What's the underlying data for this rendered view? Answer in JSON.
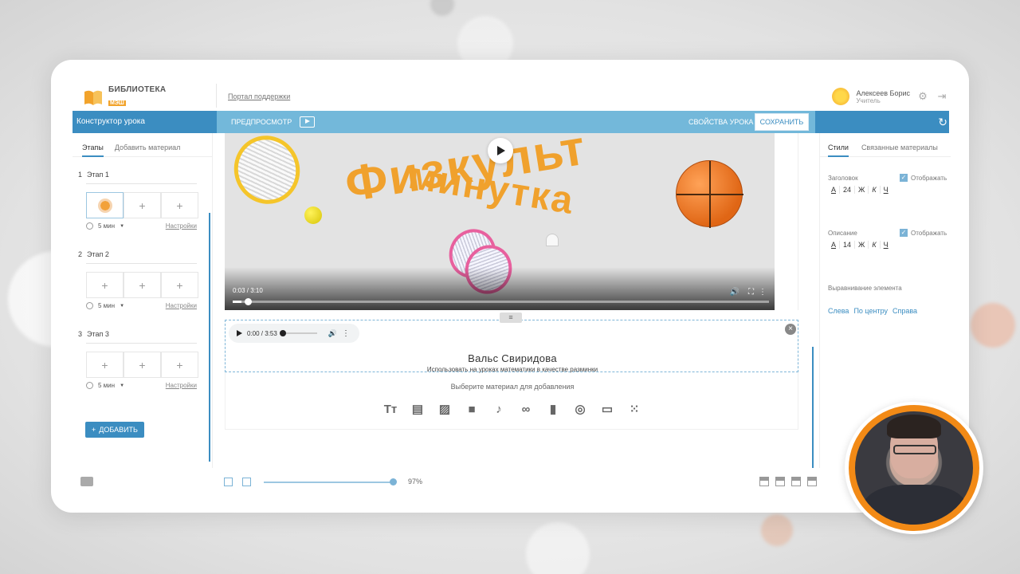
{
  "app": {
    "logo_line1": "БИБЛИОТЕКА",
    "logo_line2": "МЭШ",
    "support_link": "Портал поддержки"
  },
  "user": {
    "name": "Алексеев Борис",
    "role": "Учитель"
  },
  "toolbar": {
    "section_title": "Конструктор урока",
    "preview_label": "ПРЕДПРОСМОТР",
    "properties_label": "СВОЙСТВА УРОКА",
    "save_label": "СОХРАНИТЬ"
  },
  "left_panel": {
    "tabs": [
      "Этапы",
      "Добавить материал"
    ],
    "stages": [
      {
        "num": "1",
        "title": "Этап 1",
        "duration": "5 мин",
        "settings": "Настройки"
      },
      {
        "num": "2",
        "title": "Этап 2",
        "duration": "5 мин",
        "settings": "Настройки"
      },
      {
        "num": "3",
        "title": "Этап 3",
        "duration": "5 мин",
        "settings": "Настройки"
      }
    ],
    "add_button": "ДОБАВИТЬ",
    "add_glyph": "+",
    "cell_glyph": "+"
  },
  "video": {
    "title_line1": "Физкульт",
    "title_line2": "минутка",
    "time": "0:03 / 3:10",
    "progress": 0.016
  },
  "audio": {
    "time": "0:00 / 3:53",
    "title": "Вальс Свиридова",
    "description": "Использовать на уроках математики в качестве разминки",
    "close_glyph": "×"
  },
  "picker": {
    "label": "Выберите материал для добавления",
    "icons": [
      {
        "name": "text-icon",
        "glyph": "Tт"
      },
      {
        "name": "article-icon",
        "glyph": "▤"
      },
      {
        "name": "image-icon",
        "glyph": "▨"
      },
      {
        "name": "video-icon",
        "glyph": "■"
      },
      {
        "name": "music-icon",
        "glyph": "♪"
      },
      {
        "name": "link-icon",
        "glyph": "∞"
      },
      {
        "name": "document-icon",
        "glyph": "▮"
      },
      {
        "name": "fingerprint-icon",
        "glyph": "◎"
      },
      {
        "name": "window-icon",
        "glyph": "▭"
      },
      {
        "name": "apps-icon",
        "glyph": "⁙"
      }
    ]
  },
  "right_panel": {
    "tabs": [
      "Стили",
      "Связанные материалы"
    ],
    "heading_label": "Заголовок",
    "description_label": "Описание",
    "show_label": "Отображать",
    "heading_size": "24",
    "description_size": "14",
    "font_color_glyph": "A",
    "bold_glyph": "Ж",
    "italic_glyph": "К",
    "underline_glyph": "Ч",
    "align_label": "Выравнивание элемента",
    "align_options": [
      "Слева",
      "По центру",
      "Справа"
    ]
  },
  "bottom": {
    "zoom": "97%"
  },
  "colors": {
    "primary": "#3b8dc1",
    "toolbar": "#73b8da",
    "accent": "#f0a12d"
  }
}
